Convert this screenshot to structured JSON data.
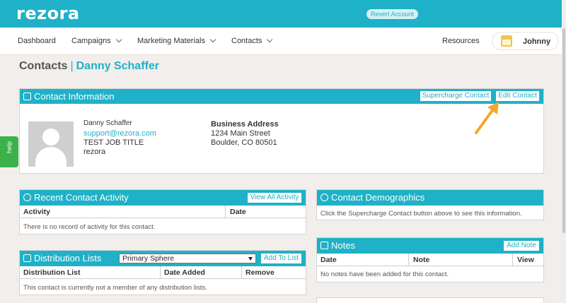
{
  "brand": {
    "logo": "rezora",
    "revert_label": "Revert Account"
  },
  "nav": {
    "items": [
      {
        "label": "Dashboard",
        "dropdown": false
      },
      {
        "label": "Campaigns",
        "dropdown": true
      },
      {
        "label": "Marketing Materials",
        "dropdown": true
      },
      {
        "label": "Contacts",
        "dropdown": true
      }
    ],
    "resources": "Resources",
    "user": "Johnny"
  },
  "heading": {
    "section": "Contacts",
    "separator": "|",
    "contact_name": "Danny Schaffer"
  },
  "contact_info": {
    "title": "Contact Information",
    "supercharge_label": "Supercharge Contact",
    "edit_label": "Edit Contact",
    "name": "Danny Schaffer",
    "email": "support@rezora.com",
    "job_title": "TEST JOB TITLE",
    "company": "rezora",
    "address_title": "Business Address",
    "address_line1": "1234 Main Street",
    "address_line2": "Boulder, CO 80501"
  },
  "activity": {
    "title": "Recent Contact Activity",
    "view_all_label": "View All Activity",
    "columns": [
      "Activity",
      "Date"
    ],
    "empty": "There is no record of activity for this contact."
  },
  "demographics": {
    "title": "Contact Demographics",
    "message": "Click the Supercharge Contact button above to see this information."
  },
  "distribution": {
    "title": "Distribution Lists",
    "selected_list": "Primary Sphere",
    "add_label": "Add To List",
    "columns": [
      "Distribution List",
      "Date Added",
      "Remove"
    ],
    "empty": "This contact is currently not a member of any distribution lists."
  },
  "notes": {
    "title": "Notes",
    "add_label": "Add Note",
    "columns": [
      "Date",
      "Note",
      "View"
    ],
    "empty": "No notes have been added for this contact."
  },
  "help_label": "help",
  "colors": {
    "brand": "#1fb1c7",
    "help": "#3bb14a",
    "arrow": "#f3a72b",
    "background": "#f1eeec"
  }
}
